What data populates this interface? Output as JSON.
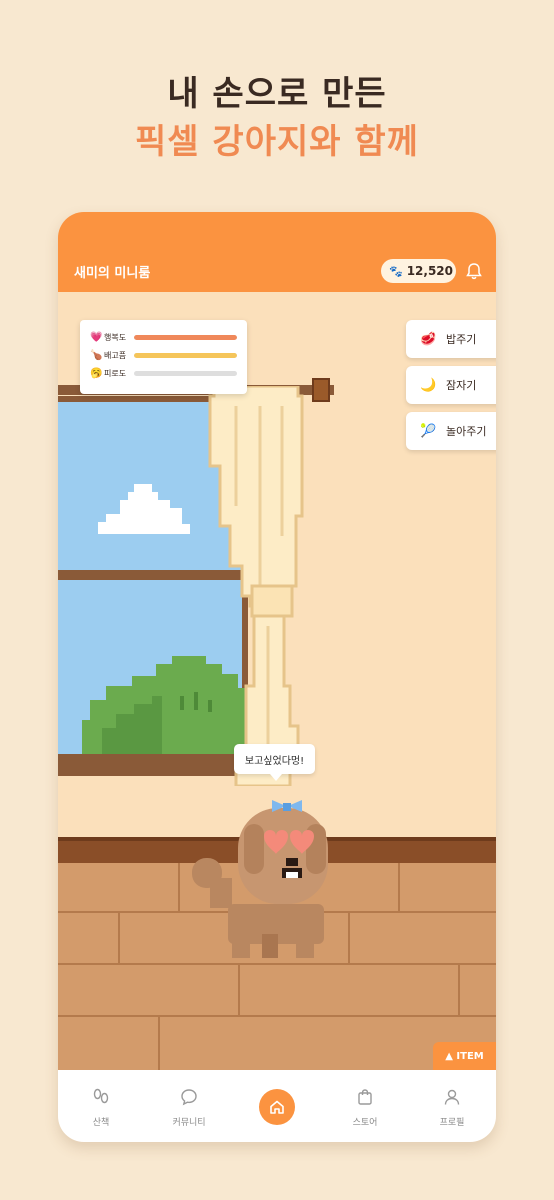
{
  "promo": {
    "line1": "내 손으로 만든",
    "line2": "픽셀 강아지와 함께"
  },
  "header": {
    "title": "새미의 미니룸",
    "coins": "12,520",
    "coin_icon": "paw-icon",
    "bell_icon": "bell-icon"
  },
  "stats": [
    {
      "emoji": "💗",
      "label": "행복도",
      "value": 1.0,
      "color": "#f0885a"
    },
    {
      "emoji": "🍗",
      "label": "배고픔",
      "value": 1.0,
      "color": "#f5c55a"
    },
    {
      "emoji": "🥱",
      "label": "피로도",
      "value": 0.0,
      "color": "#dedede"
    }
  ],
  "actions": [
    {
      "icon": "🥩",
      "label": "밥주기"
    },
    {
      "icon": "🌙",
      "label": "잠자기"
    },
    {
      "icon": "🎾",
      "label": "놀아주기"
    }
  ],
  "speech": "보고싶었다멍!",
  "item_button": "▲ ITEM",
  "tabs": [
    {
      "label": "산책",
      "icon": "footprints-icon"
    },
    {
      "label": "커뮤니티",
      "icon": "chat-bubble-icon"
    },
    {
      "label": "",
      "icon": "home-icon"
    },
    {
      "label": "스토어",
      "icon": "shopping-bag-icon"
    },
    {
      "label": "프로필",
      "icon": "user-icon"
    }
  ],
  "colors": {
    "accent": "#fb9340",
    "background": "#f8e8d0",
    "headline_dark": "#3a2a22",
    "headline_accent": "#f08a52"
  }
}
